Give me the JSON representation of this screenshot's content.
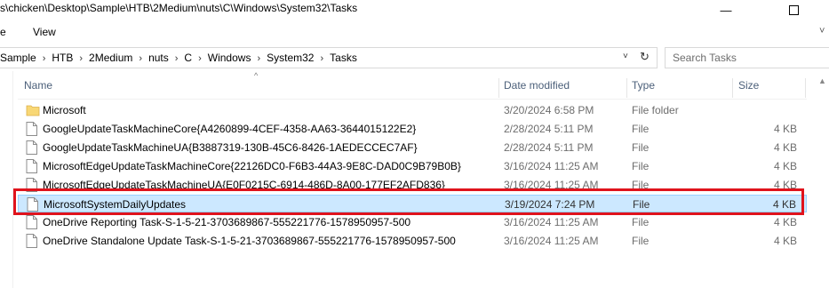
{
  "window": {
    "title": "s\\chicken\\Desktop\\Sample\\HTB\\2Medium\\nuts\\C\\Windows\\System32\\Tasks",
    "minimize": "—"
  },
  "ribbon": {
    "tabs": [
      {
        "label": "e"
      },
      {
        "label": "View"
      }
    ],
    "expand": "˅"
  },
  "address": {
    "crumbs": [
      "Sample",
      "HTB",
      "2Medium",
      "nuts",
      "C",
      "Windows",
      "System32",
      "Tasks"
    ],
    "separator": "›",
    "dropdown": "˅",
    "refresh": "↻"
  },
  "search": {
    "placeholder": "Search Tasks"
  },
  "columns": {
    "sort_indicator": "^",
    "name": "Name",
    "date": "Date modified",
    "type": "Type",
    "size": "Size"
  },
  "files": [
    {
      "name": "Microsoft",
      "date": "3/20/2024 6:58 PM",
      "type": "File folder",
      "size": "",
      "icon": "folder-icon"
    },
    {
      "name": "GoogleUpdateTaskMachineCore{A4260899-4CEF-4358-AA63-3644015122E2}",
      "date": "2/28/2024 5:11 PM",
      "type": "File",
      "size": "4 KB",
      "icon": "file-icon"
    },
    {
      "name": "GoogleUpdateTaskMachineUA{B3887319-130B-45C6-8426-1AEDECCEC7AF}",
      "date": "2/28/2024 5:11 PM",
      "type": "File",
      "size": "4 KB",
      "icon": "file-icon"
    },
    {
      "name": "MicrosoftEdgeUpdateTaskMachineCore{22126DC0-F6B3-44A3-9E8C-DAD0C9B79B0B}",
      "date": "3/16/2024 11:25 AM",
      "type": "File",
      "size": "4 KB",
      "icon": "file-icon"
    },
    {
      "name": "MicrosoftEdgeUpdateTaskMachineUA{E0F0215C-6914-486D-8A00-177EF2AFD836}",
      "date": "3/16/2024 11:25 AM",
      "type": "File",
      "size": "4 KB",
      "icon": "file-icon"
    },
    {
      "name": "MicrosoftSystemDailyUpdates",
      "date": "3/19/2024 7:24 PM",
      "type": "File",
      "size": "4 KB",
      "icon": "file-icon",
      "selected": true
    },
    {
      "name": "OneDrive Reporting Task-S-1-5-21-3703689867-555221776-1578950957-500",
      "date": "3/16/2024 11:25 AM",
      "type": "File",
      "size": "4 KB",
      "icon": "file-icon"
    },
    {
      "name": "OneDrive Standalone Update Task-S-1-5-21-3703689867-555221776-1578950957-500",
      "date": "3/16/2024 11:25 AM",
      "type": "File",
      "size": "4 KB",
      "icon": "file-icon"
    }
  ],
  "colors": {
    "selection": "#cce8ff",
    "highlight_border": "#e0131c",
    "folder": "#f8d775"
  }
}
